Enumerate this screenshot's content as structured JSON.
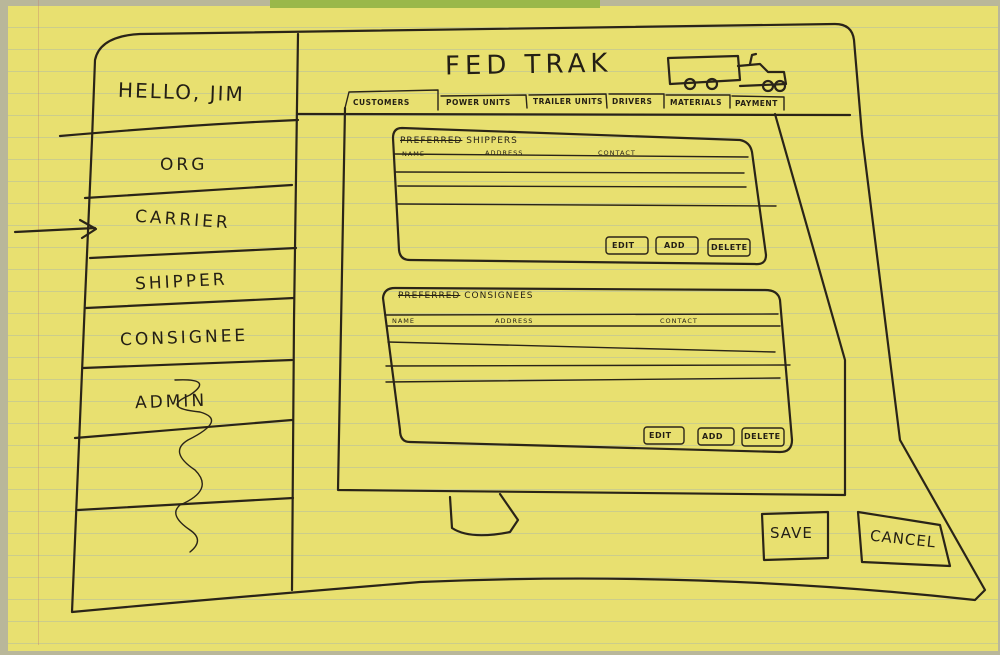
{
  "app": {
    "title": "FED TRAK",
    "logo_icon": "truck-icon"
  },
  "greeting": "HELLO, JIM",
  "sidebar": {
    "items": [
      {
        "label": "ORG"
      },
      {
        "label": "CARRIER",
        "selected": true
      },
      {
        "label": "SHIPPER"
      },
      {
        "label": "CONSIGNEE"
      },
      {
        "label": "ADMIN"
      }
    ],
    "selected_indicator_icon": "arrow-right-icon"
  },
  "tabs": [
    {
      "label": "CUSTOMERS",
      "active": true
    },
    {
      "label": "POWER UNITS"
    },
    {
      "label": "TRAILER UNITS"
    },
    {
      "label": "DRIVERS"
    },
    {
      "label": "MATERIALS"
    },
    {
      "label": "PAYMENT"
    }
  ],
  "shippers": {
    "struck_word": "PREFERRED",
    "title": "SHIPPERS",
    "columns": [
      "NAME",
      "ADDRESS",
      "CONTACT"
    ],
    "buttons": {
      "edit": "EDIT",
      "add": "ADD",
      "delete": "DELETE"
    }
  },
  "consignees": {
    "struck_word": "PREFERRED",
    "title": "CONSIGNEES",
    "columns": [
      "NAME",
      "ADDRESS",
      "CONTACT"
    ],
    "buttons": {
      "edit": "EDIT",
      "add": "ADD",
      "delete": "DELETE"
    }
  },
  "footer": {
    "save_label": "SAVE",
    "cancel_label": "CANCEL"
  }
}
